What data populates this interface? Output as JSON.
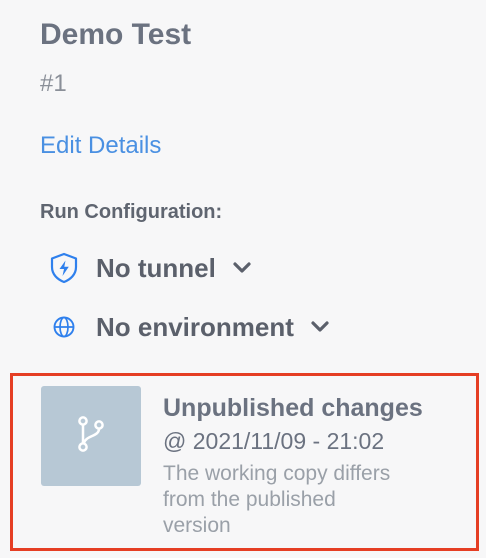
{
  "test": {
    "name": "Demo Test",
    "number": "#1",
    "edit_label": "Edit Details"
  },
  "run_configuration": {
    "label": "Run Configuration:",
    "tunnel": {
      "value": "No tunnel",
      "icon": "shield-bolt-icon"
    },
    "environment": {
      "value": "No environment",
      "icon": "globe-icon"
    }
  },
  "changes": {
    "title": "Unpublished changes",
    "timestamp": "@ 2021/11/09 - 21:02",
    "description": "The working copy differs from the published version",
    "icon": "git-branch-icon"
  },
  "colors": {
    "link": "#4a90e2",
    "icon_blue": "#2f80ed",
    "highlight_border": "#e53e24",
    "thumb_bg": "#b7c8d5"
  }
}
